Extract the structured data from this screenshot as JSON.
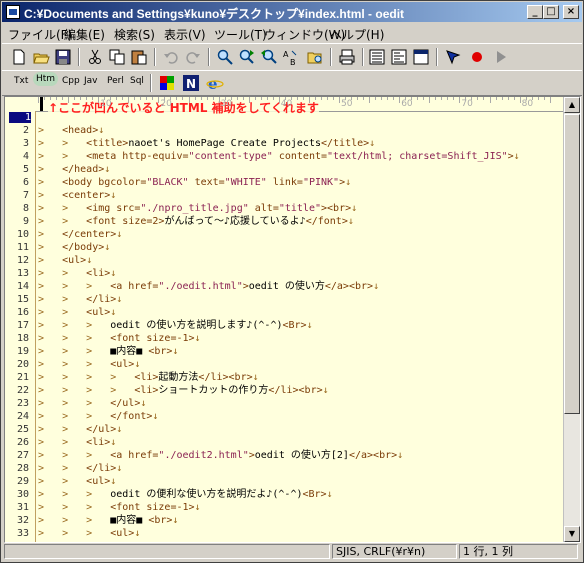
{
  "window": {
    "title": "C:¥Documents and Settings¥kuno¥デスクトップ¥index.html - oedit",
    "minimize": "_",
    "maximize": "□",
    "close": "×"
  },
  "menu": [
    "ファイル(F)",
    "編集(E)",
    "検索(S)",
    "表示(V)",
    "ツール(T)",
    "ウィンドウ(W)",
    "ヘルプ(H)"
  ],
  "toolbar": {
    "icons": [
      "new-icon",
      "open-icon",
      "save-icon",
      "cut-icon",
      "copy-icon",
      "paste-icon",
      "undo-icon",
      "redo-icon",
      "find-icon",
      "find-next-icon",
      "find-prev-icon",
      "replace-icon",
      "open-folder-icon",
      "print-icon",
      "view1-icon",
      "view2-icon",
      "window-icon",
      "bookmark-icon",
      "record-icon",
      "play-icon"
    ]
  },
  "langbar": {
    "items": [
      "Txt",
      "Htm",
      "Cpp",
      "Jav",
      "Perl",
      "Sql"
    ],
    "active": "Htm"
  },
  "annotation": "↑ここが凹んでいると HTML 補助をしてくれます",
  "ruler": {
    "numbers": [
      "10",
      "20",
      "30",
      "40",
      "50",
      "60",
      "70",
      "80"
    ]
  },
  "colors": {
    "editor_bg": "#ffffdd",
    "annotation": "#ff2020",
    "tag": "#7a3b06",
    "value": "#8b2252"
  },
  "code_lines": [
    [
      {
        "t": "",
        "c": "txt"
      }
    ],
    [
      {
        "t": ">   ",
        "c": "gt"
      },
      {
        "t": "<head>",
        "c": "tag"
      },
      {
        "t": "↓",
        "c": "gt"
      }
    ],
    [
      {
        "t": ">   >   ",
        "c": "gt"
      },
      {
        "t": "<title>",
        "c": "tag"
      },
      {
        "t": "naoet's HomePage Create Projects",
        "c": "txt"
      },
      {
        "t": "</title>",
        "c": "tag"
      },
      {
        "t": "↓",
        "c": "gt"
      }
    ],
    [
      {
        "t": ">   >   ",
        "c": "gt"
      },
      {
        "t": "<meta http-equiv=",
        "c": "tag"
      },
      {
        "t": "\"content-type\"",
        "c": "val"
      },
      {
        "t": " content=",
        "c": "tag"
      },
      {
        "t": "\"text/html; charset=Shift_JIS\"",
        "c": "val"
      },
      {
        "t": ">",
        "c": "tag"
      },
      {
        "t": "↓",
        "c": "gt"
      }
    ],
    [
      {
        "t": ">   ",
        "c": "gt"
      },
      {
        "t": "</head>",
        "c": "tag"
      },
      {
        "t": "↓",
        "c": "gt"
      }
    ],
    [
      {
        "t": ">   ",
        "c": "gt"
      },
      {
        "t": "<body bgcolor=",
        "c": "tag"
      },
      {
        "t": "\"BLACK\"",
        "c": "val"
      },
      {
        "t": " text=",
        "c": "tag"
      },
      {
        "t": "\"WHITE\"",
        "c": "val"
      },
      {
        "t": " link=",
        "c": "tag"
      },
      {
        "t": "\"PINK\"",
        "c": "val"
      },
      {
        "t": ">",
        "c": "tag"
      },
      {
        "t": "↓",
        "c": "gt"
      }
    ],
    [
      {
        "t": ">   ",
        "c": "gt"
      },
      {
        "t": "<center>",
        "c": "tag"
      },
      {
        "t": "↓",
        "c": "gt"
      }
    ],
    [
      {
        "t": ">   >   ",
        "c": "gt"
      },
      {
        "t": "<img src=",
        "c": "tag"
      },
      {
        "t": "\"./npro_title.jpg\"",
        "c": "val"
      },
      {
        "t": " alt=",
        "c": "tag"
      },
      {
        "t": "\"title\"",
        "c": "val"
      },
      {
        "t": ">",
        "c": "tag"
      },
      {
        "t": "<br>",
        "c": "tag"
      },
      {
        "t": "↓",
        "c": "gt"
      }
    ],
    [
      {
        "t": ">   >   ",
        "c": "gt"
      },
      {
        "t": "<font size=2>",
        "c": "tag"
      },
      {
        "t": "がんばって～♪応援しているよ♪",
        "c": "txt"
      },
      {
        "t": "</font>",
        "c": "tag"
      },
      {
        "t": "↓",
        "c": "gt"
      }
    ],
    [
      {
        "t": ">   ",
        "c": "gt"
      },
      {
        "t": "</center>",
        "c": "tag"
      },
      {
        "t": "↓",
        "c": "gt"
      }
    ],
    [
      {
        "t": ">   ",
        "c": "gt"
      },
      {
        "t": "</body>",
        "c": "tag"
      },
      {
        "t": "↓",
        "c": "gt"
      }
    ],
    [
      {
        "t": ">   ",
        "c": "gt"
      },
      {
        "t": "<ul>",
        "c": "tag"
      },
      {
        "t": "↓",
        "c": "gt"
      }
    ],
    [
      {
        "t": ">   >   ",
        "c": "gt"
      },
      {
        "t": "<li>",
        "c": "tag"
      },
      {
        "t": "↓",
        "c": "gt"
      }
    ],
    [
      {
        "t": ">   >   >   ",
        "c": "gt"
      },
      {
        "t": "<a href=",
        "c": "tag"
      },
      {
        "t": "\"./oedit.html\"",
        "c": "val"
      },
      {
        "t": ">",
        "c": "tag"
      },
      {
        "t": "oedit の使い方",
        "c": "txt"
      },
      {
        "t": "</a>",
        "c": "tag"
      },
      {
        "t": "<br>",
        "c": "tag"
      },
      {
        "t": "↓",
        "c": "gt"
      }
    ],
    [
      {
        "t": ">   >   ",
        "c": "gt"
      },
      {
        "t": "</li>",
        "c": "tag"
      },
      {
        "t": "↓",
        "c": "gt"
      }
    ],
    [
      {
        "t": ">   >   ",
        "c": "gt"
      },
      {
        "t": "<ul>",
        "c": "tag"
      },
      {
        "t": "↓",
        "c": "gt"
      }
    ],
    [
      {
        "t": ">   >   >   ",
        "c": "gt"
      },
      {
        "t": "oedit の使い方を説明します♪(^-^)",
        "c": "txt"
      },
      {
        "t": "<Br>",
        "c": "tag"
      },
      {
        "t": "↓",
        "c": "gt"
      }
    ],
    [
      {
        "t": ">   >   >   ",
        "c": "gt"
      },
      {
        "t": "<font size=-1>",
        "c": "tag"
      },
      {
        "t": "↓",
        "c": "gt"
      }
    ],
    [
      {
        "t": ">   >   >   ",
        "c": "gt"
      },
      {
        "t": "■内容■ ",
        "c": "txt"
      },
      {
        "t": "<br>",
        "c": "tag"
      },
      {
        "t": "↓",
        "c": "gt"
      }
    ],
    [
      {
        "t": ">   >   >   ",
        "c": "gt"
      },
      {
        "t": "<ul>",
        "c": "tag"
      },
      {
        "t": "↓",
        "c": "gt"
      }
    ],
    [
      {
        "t": ">   >   >   >   ",
        "c": "gt"
      },
      {
        "t": "<li>",
        "c": "tag"
      },
      {
        "t": "起動方法",
        "c": "txt"
      },
      {
        "t": "</li>",
        "c": "tag"
      },
      {
        "t": "<br>",
        "c": "tag"
      },
      {
        "t": "↓",
        "c": "gt"
      }
    ],
    [
      {
        "t": ">   >   >   >   ",
        "c": "gt"
      },
      {
        "t": "<li>",
        "c": "tag"
      },
      {
        "t": "ショートカットの作り方",
        "c": "txt"
      },
      {
        "t": "</li>",
        "c": "tag"
      },
      {
        "t": "<br>",
        "c": "tag"
      },
      {
        "t": "↓",
        "c": "gt"
      }
    ],
    [
      {
        "t": ">   >   >   ",
        "c": "gt"
      },
      {
        "t": "</ul>",
        "c": "tag"
      },
      {
        "t": "↓",
        "c": "gt"
      }
    ],
    [
      {
        "t": ">   >   >   ",
        "c": "gt"
      },
      {
        "t": "</font>",
        "c": "tag"
      },
      {
        "t": "↓",
        "c": "gt"
      }
    ],
    [
      {
        "t": ">   >   ",
        "c": "gt"
      },
      {
        "t": "</ul>",
        "c": "tag"
      },
      {
        "t": "↓",
        "c": "gt"
      }
    ],
    [
      {
        "t": ">   >   ",
        "c": "gt"
      },
      {
        "t": "<li>",
        "c": "tag"
      },
      {
        "t": "↓",
        "c": "gt"
      }
    ],
    [
      {
        "t": ">   >   >   ",
        "c": "gt"
      },
      {
        "t": "<a href=",
        "c": "tag"
      },
      {
        "t": "\"./oedit2.html\"",
        "c": "val"
      },
      {
        "t": ">",
        "c": "tag"
      },
      {
        "t": "oedit の使い方[2]",
        "c": "txt"
      },
      {
        "t": "</a>",
        "c": "tag"
      },
      {
        "t": "<br>",
        "c": "tag"
      },
      {
        "t": "↓",
        "c": "gt"
      }
    ],
    [
      {
        "t": ">   >   ",
        "c": "gt"
      },
      {
        "t": "</li>",
        "c": "tag"
      },
      {
        "t": "↓",
        "c": "gt"
      }
    ],
    [
      {
        "t": ">   >   ",
        "c": "gt"
      },
      {
        "t": "<ul>",
        "c": "tag"
      },
      {
        "t": "↓",
        "c": "gt"
      }
    ],
    [
      {
        "t": ">   >   >   ",
        "c": "gt"
      },
      {
        "t": "oedit の便利な使い方を説明だよ♪(^-^)",
        "c": "txt"
      },
      {
        "t": "<Br>",
        "c": "tag"
      },
      {
        "t": "↓",
        "c": "gt"
      }
    ],
    [
      {
        "t": ">   >   >   ",
        "c": "gt"
      },
      {
        "t": "<font size=-1>",
        "c": "tag"
      },
      {
        "t": "↓",
        "c": "gt"
      }
    ],
    [
      {
        "t": ">   >   >   ",
        "c": "gt"
      },
      {
        "t": "■内容■ ",
        "c": "txt"
      },
      {
        "t": "<br>",
        "c": "tag"
      },
      {
        "t": "↓",
        "c": "gt"
      }
    ],
    [
      {
        "t": ">   >   >   ",
        "c": "gt"
      },
      {
        "t": "<ul>",
        "c": "tag"
      },
      {
        "t": "↓",
        "c": "gt"
      }
    ]
  ],
  "line_numbers": [
    "1",
    "2",
    "3",
    "4",
    "5",
    "6",
    "7",
    "8",
    "9",
    "10",
    "11",
    "12",
    "13",
    "14",
    "15",
    "16",
    "17",
    "18",
    "19",
    "20",
    "21",
    "22",
    "23",
    "24",
    "25",
    "26",
    "27",
    "28",
    "29",
    "30",
    "31",
    "32",
    "33"
  ],
  "current_line": "1",
  "status": {
    "encoding": "SJIS, CRLF(¥r¥n)",
    "position": "1 行, 1 列"
  }
}
